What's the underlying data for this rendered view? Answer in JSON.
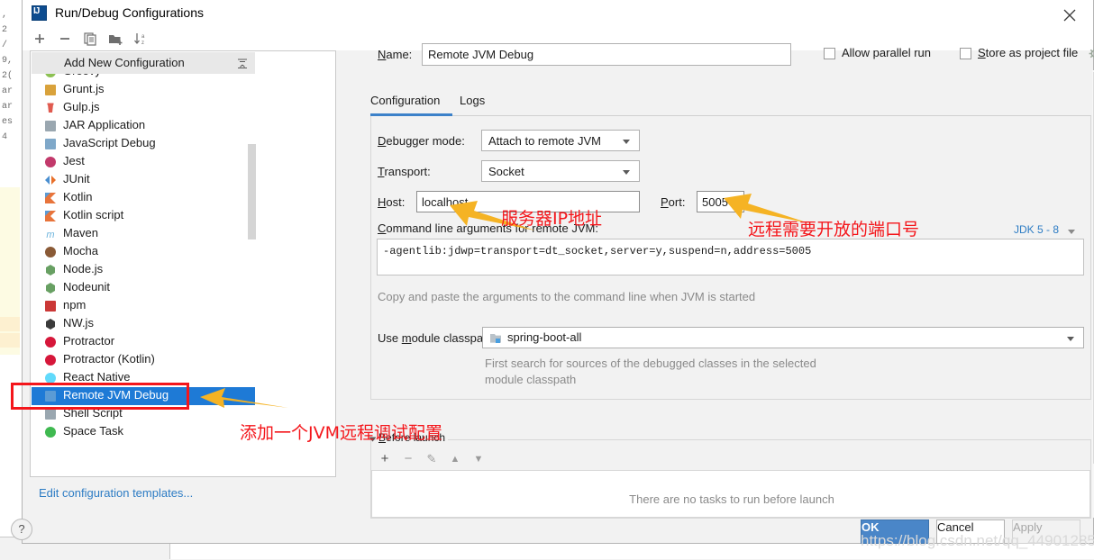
{
  "window": {
    "title": "Run/Debug Configurations",
    "logo_text": "IJ",
    "close_icon": "close-icon"
  },
  "toolbar": {
    "buttons": [
      {
        "name": "add-configuration-button",
        "glyph": "+"
      },
      {
        "name": "remove-configuration-button",
        "glyph": "−"
      },
      {
        "name": "copy-configuration-button",
        "glyph": "⎘"
      },
      {
        "name": "new-folder-button",
        "glyph": "▤"
      },
      {
        "name": "sort-alphabetically-button",
        "glyph": "↓"
      }
    ]
  },
  "sidebar": {
    "add_new_configuration": "Add New Configuration",
    "collapse_icon": "expand-collapse-icon",
    "edit_templates_link": "Edit configuration templates...",
    "selected_item": "Remote JVM Debug",
    "items": [
      {
        "label": "Groovy",
        "icon": "groovy-icon",
        "color": "#8cc152",
        "shape": "circle"
      },
      {
        "label": "Grunt.js",
        "icon": "grunt-icon",
        "color": "#d9a23b",
        "shape": "square"
      },
      {
        "label": "Gulp.js",
        "icon": "gulp-icon",
        "color": "#e05a4f",
        "shape": "cup"
      },
      {
        "label": "JAR Application",
        "icon": "jar-icon",
        "color": "#9aa7b0",
        "shape": "square"
      },
      {
        "label": "JavaScript Debug",
        "icon": "javascript-debug-icon",
        "color": "#7fa8c9",
        "shape": "square"
      },
      {
        "label": "Jest",
        "icon": "jest-icon",
        "color": "#c2396b",
        "shape": "circle"
      },
      {
        "label": "JUnit",
        "icon": "junit-icon",
        "color": "#e8702a",
        "shape": "triangles"
      },
      {
        "label": "Kotlin",
        "icon": "kotlin-icon",
        "color": "#e8743b",
        "shape": "kotlin"
      },
      {
        "label": "Kotlin script",
        "icon": "kotlin-script-icon",
        "color": "#e8743b",
        "shape": "kotlin"
      },
      {
        "label": "Maven",
        "icon": "maven-icon",
        "color": "#6eb5dd",
        "shape": "letter"
      },
      {
        "label": "Mocha",
        "icon": "mocha-icon",
        "color": "#8a5a36",
        "shape": "circle"
      },
      {
        "label": "Node.js",
        "icon": "nodejs-icon",
        "color": "#68a063",
        "shape": "hexagon"
      },
      {
        "label": "Nodeunit",
        "icon": "nodeunit-icon",
        "color": "#68a063",
        "shape": "hexagon"
      },
      {
        "label": "npm",
        "icon": "npm-icon",
        "color": "#cb3837",
        "shape": "square"
      },
      {
        "label": "NW.js",
        "icon": "nwjs-icon",
        "color": "#3b3b3b",
        "shape": "hexagon"
      },
      {
        "label": "Protractor",
        "icon": "protractor-icon",
        "color": "#d6173a",
        "shape": "circle"
      },
      {
        "label": "Protractor (Kotlin)",
        "icon": "protractor-kotlin-icon",
        "color": "#d6173a",
        "shape": "circle"
      },
      {
        "label": "React Native",
        "icon": "react-native-icon",
        "color": "#61dafb",
        "shape": "circle"
      },
      {
        "label": "Remote JVM Debug",
        "icon": "remote-jvm-debug-icon",
        "color": "#5b9bd5",
        "shape": "square"
      },
      {
        "label": "Shell Script",
        "icon": "shell-script-icon",
        "color": "#9aa7b0",
        "shape": "square"
      },
      {
        "label": "Space Task",
        "icon": "space-task-icon",
        "color": "#3fb950",
        "shape": "circle"
      }
    ]
  },
  "form": {
    "name_label": "Name:",
    "name_label_mnemonic": "N",
    "name_value": "Remote JVM Debug",
    "allow_parallel_run": {
      "label": "Allow parallel run",
      "checked": false
    },
    "store_as_project_file": {
      "label": "Store as project file",
      "checked": false
    },
    "gear_icon": "gear-icon",
    "tabs": [
      {
        "label": "Configuration",
        "active": true
      },
      {
        "label": "Logs",
        "active": false
      }
    ],
    "debugger_mode": {
      "label": "Debugger mode:",
      "mnemonic": "D",
      "value": "Attach to remote JVM"
    },
    "transport": {
      "label": "Transport:",
      "mnemonic": "T",
      "value": "Socket"
    },
    "host": {
      "label": "Host:",
      "mnemonic": "H",
      "value": "localhost"
    },
    "port": {
      "label": "Port:",
      "mnemonic": "P",
      "value": "5005"
    },
    "jdk_link": "JDK 5 - 8",
    "command_line_args": {
      "label": "Command line arguments for remote JVM:",
      "mnemonic": "C",
      "value": "-agentlib:jdwp=transport=dt_socket,server=y,suspend=n,address=5005"
    },
    "args_hint": "Copy and paste the arguments to the command line when JVM is started",
    "module_classpath": {
      "label": "Use module classpath:",
      "mnemonic": "m",
      "value": "spring-boot-all",
      "icon": "module-icon"
    },
    "classpath_desc_line1": "First search for sources of the debugged classes in the selected",
    "classpath_desc_line2": "module classpath"
  },
  "before_launch": {
    "legend": "Before launch",
    "mnemonic": "B",
    "empty_message": "There are no tasks to run before launch",
    "buttons": [
      {
        "name": "add-task-button",
        "glyph": "+"
      },
      {
        "name": "remove-task-button",
        "glyph": "−"
      },
      {
        "name": "edit-task-button",
        "glyph": "✎"
      },
      {
        "name": "move-up-button",
        "glyph": "▲"
      },
      {
        "name": "move-down-button",
        "glyph": "▼"
      }
    ]
  },
  "footer": {
    "help_glyph": "?",
    "ok": "OK",
    "cancel": "Cancel",
    "apply": "Apply"
  },
  "annotations": {
    "host_note": "服务器IP地址",
    "port_note": "远程需要开放的端口号",
    "sidebar_note": "添加一个JVM远程调试配置",
    "arrow_color": "#f5b324",
    "text_color": "#f4161b",
    "rect_color": "#f4161b"
  },
  "watermark": "https://blog.csdn.net/qq_44901285",
  "background_editor_lines": [
    ",",
    "2",
    "/",
    "9,",
    "2(",
    "",
    "",
    "",
    "ar",
    "ar",
    "es",
    "4"
  ]
}
